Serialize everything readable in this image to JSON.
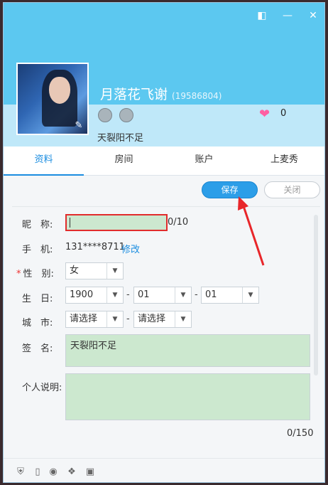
{
  "window": {
    "top_icons": [
      "shirt-icon",
      "minimize-icon",
      "close-icon"
    ]
  },
  "profile": {
    "nickname": "月落花飞谢",
    "uid": "(19586804)",
    "heart_count": "0",
    "signature_line": "天裂阳不足"
  },
  "tabs": [
    {
      "label": "资料"
    },
    {
      "label": "房间"
    },
    {
      "label": "账户"
    },
    {
      "label": "上麦秀"
    }
  ],
  "buttons": {
    "save": "保存",
    "close": "关闭"
  },
  "form": {
    "nickname_label": "昵　称:",
    "nickname_value": "",
    "nickname_count": "0/10",
    "phone_label": "手　机:",
    "phone_value": "131****8711",
    "phone_edit": "修改",
    "gender_label": "性　别:",
    "gender_value": "女",
    "birthday_label": "生　日:",
    "birth_year": "1900",
    "birth_month": "01",
    "birth_day": "01",
    "city_label": "城　市:",
    "province_value": "请选择",
    "city_value": "请选择",
    "signature_label": "签　名:",
    "signature_value": "天裂阳不足",
    "bio_label": "个人说明:",
    "bio_value": "",
    "bio_count": "0/150",
    "dash": "-"
  },
  "colors": {
    "accent": "#2c9ee8",
    "header": "#5cc8f0",
    "highlight": "#e12c2c",
    "field_fill": "#cce8cf"
  }
}
